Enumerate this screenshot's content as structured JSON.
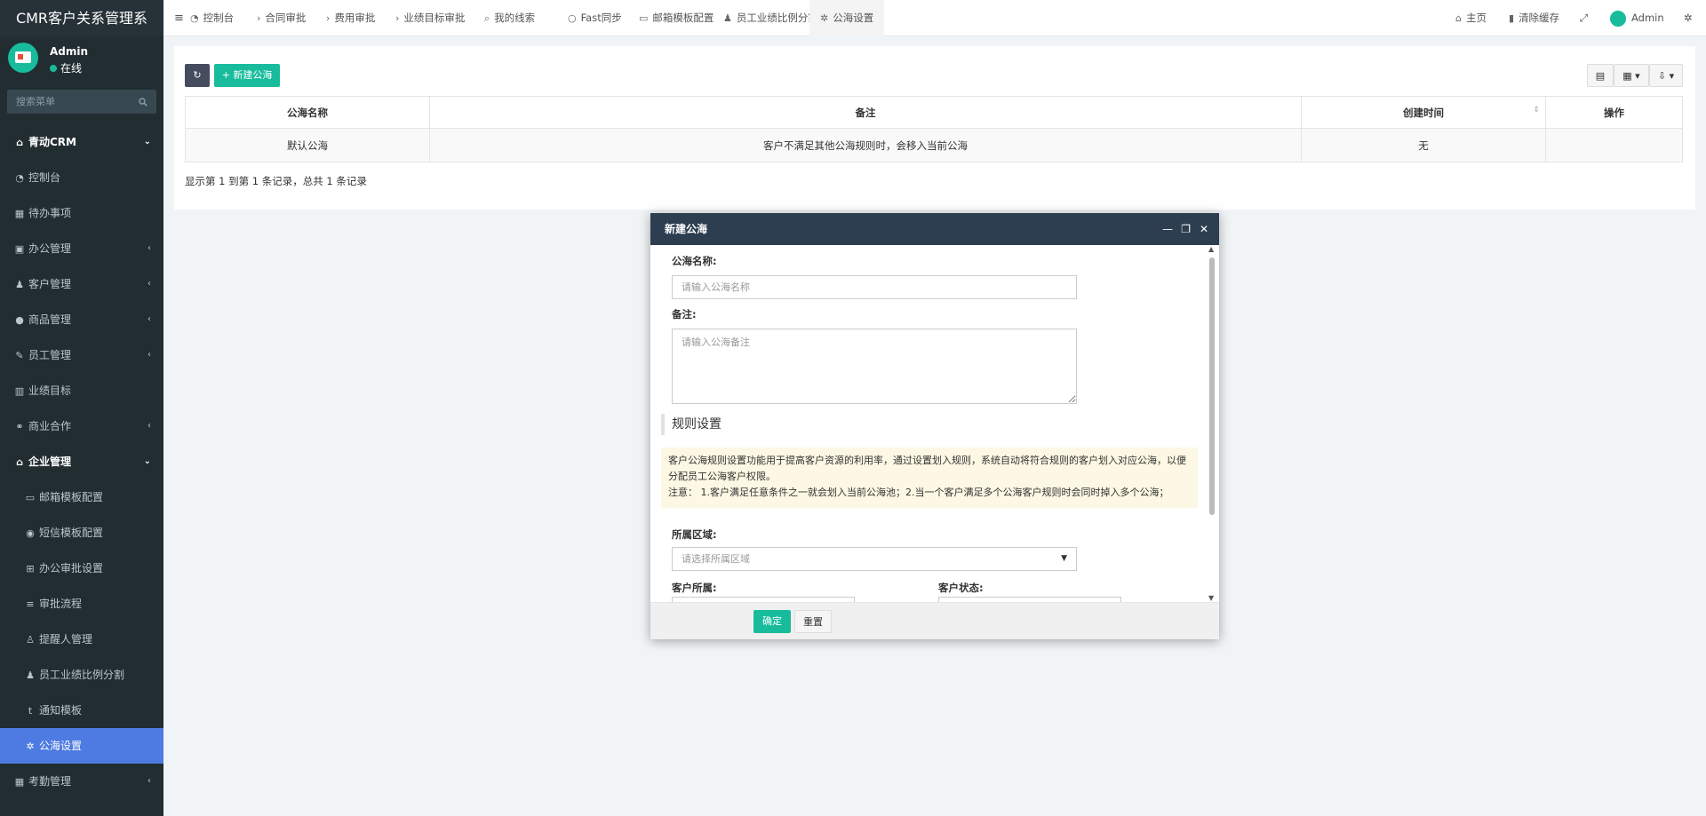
{
  "app": {
    "title": "CMR客户关系管理系"
  },
  "user": {
    "name": "Admin",
    "status": "在线"
  },
  "side_search": {
    "placeholder": "搜索菜单"
  },
  "menu": [
    {
      "label": "青动CRM",
      "type": "header",
      "icon": "home-icon",
      "caret": "⌄"
    },
    {
      "label": "控制台",
      "type": "item",
      "icon": "dashboard-icon",
      "caret": ""
    },
    {
      "label": "待办事项",
      "type": "item",
      "icon": "calendar-icon",
      "caret": ""
    },
    {
      "label": "办公管理",
      "type": "item",
      "icon": "windows-icon",
      "caret": "‹"
    },
    {
      "label": "客户管理",
      "type": "item",
      "icon": "users-icon",
      "caret": "‹"
    },
    {
      "label": "商品管理",
      "type": "item",
      "icon": "product-icon",
      "caret": "‹"
    },
    {
      "label": "员工管理",
      "type": "item",
      "icon": "brush-icon",
      "caret": "‹"
    },
    {
      "label": "业绩目标",
      "type": "item",
      "icon": "bar-chart-icon",
      "caret": ""
    },
    {
      "label": "商业合作",
      "type": "item",
      "icon": "handshake-icon",
      "caret": "‹"
    },
    {
      "label": "企业管理",
      "type": "header",
      "icon": "bank-icon",
      "caret": "⌄"
    },
    {
      "label": "邮箱模板配置",
      "type": "sub",
      "icon": "mail-icon",
      "caret": ""
    },
    {
      "label": "短信模板配置",
      "type": "sub",
      "icon": "sms-icon",
      "caret": ""
    },
    {
      "label": "办公审批设置",
      "type": "sub",
      "icon": "sitemap-icon",
      "caret": ""
    },
    {
      "label": "审批流程",
      "type": "sub",
      "icon": "list-icon",
      "caret": ""
    },
    {
      "label": "提醒人管理",
      "type": "sub",
      "icon": "user-icon",
      "caret": ""
    },
    {
      "label": "员工业绩比例分割",
      "type": "sub",
      "icon": "users-icon",
      "caret": ""
    },
    {
      "label": "通知模板",
      "type": "sub",
      "icon": "tumblr-icon",
      "caret": ""
    },
    {
      "label": "公海设置",
      "type": "sub",
      "icon": "cogs-icon",
      "caret": "",
      "active": true
    },
    {
      "label": "考勤管理",
      "type": "item",
      "icon": "calendar-icon",
      "caret": "‹"
    }
  ],
  "nav_tabs": [
    {
      "label": "控制台",
      "icon": "dashboard-icon"
    },
    {
      "label": "合同审批",
      "icon": "chevron-right-icon"
    },
    {
      "label": "费用审批",
      "icon": "chevron-right-icon"
    },
    {
      "label": "业绩目标审批",
      "icon": "chevron-right-icon"
    },
    {
      "label": "我的线索",
      "icon": "search-icon"
    },
    {
      "label": "Fast同步",
      "icon": "circle-icon"
    },
    {
      "label": "邮箱模板配置",
      "icon": "mail-icon"
    },
    {
      "label": "员工业绩比例分割",
      "icon": "users-icon"
    },
    {
      "label": "公海设置",
      "icon": "cogs-icon",
      "active": true
    }
  ],
  "nav_right": {
    "home": "主页",
    "clear_cache": "清除缓存",
    "admin": "Admin"
  },
  "toolbar": {
    "add_label": "新建公海"
  },
  "table": {
    "headers": [
      "公海名称",
      "备注",
      "创建时间",
      "操作"
    ],
    "rows": [
      [
        "默认公海",
        "客户不满足其他公海规则时，会移入当前公海",
        "无",
        ""
      ]
    ]
  },
  "pagination": {
    "text": "显示第 1 到第 1 条记录，总共 1 条记录"
  },
  "modal": {
    "title": "新建公海",
    "name_label": "公海名称:",
    "name_placeholder": "请输入公海名称",
    "remark_label": "备注:",
    "remark_placeholder": "请输入公海备注",
    "rule_title": "规则设置",
    "notice_line1": "客户公海规则设置功能用于提高客户资源的利用率，通过设置划入规则，系统自动将符合规则的客户划入对应公海，以便分配员工公海客户权限。",
    "notice_line2": "注意： 1.客户满足任意条件之一就会划入当前公海池；2.当一个客户满足多个公海客户规则时会同时掉入多个公海；",
    "region_label": "所属区域:",
    "region_placeholder": "请选择所属区域",
    "owner_label": "客户所属:",
    "status_label": "客户状态:",
    "ok_label": "确定",
    "reset_label": "重置"
  }
}
